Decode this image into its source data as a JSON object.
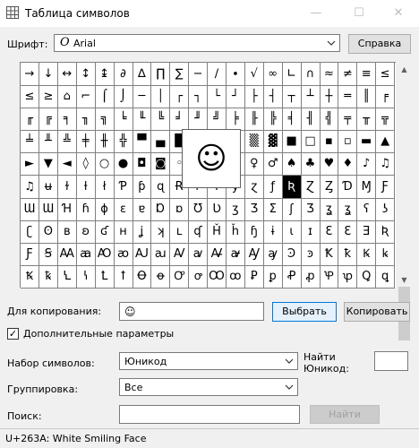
{
  "window": {
    "title": "Таблица символов",
    "minimize_glyph": "—",
    "maximize_glyph": "☐",
    "close_glyph": "✕"
  },
  "font_row": {
    "label": "Шрифт:",
    "font_icon_glyph": "O",
    "font_value": "Arial",
    "help_button": "Справка"
  },
  "grid": {
    "selected_index": 114,
    "rows": [
      [
        "→",
        "↓",
        "↔",
        "↕",
        "↨",
        "∂",
        "∆",
        "∏",
        "∑",
        "−",
        "∕",
        "∙",
        "√",
        "∞",
        "∟",
        "∩",
        "≈",
        "≠",
        "≡",
        "≤"
      ],
      [
        "≤",
        "≥",
        "⌂",
        "⌐",
        "⌠",
        "⌡",
        "─",
        "│",
        "┌",
        "┐",
        "└",
        "┘",
        "├",
        "┤",
        "┬",
        "┴",
        "┼",
        "═",
        "║",
        "╒"
      ],
      [
        "╓",
        "╔",
        "╕",
        "╖",
        "╗",
        "╘",
        "╙",
        "╚",
        "╛",
        "╜",
        "╝",
        "╞",
        "╟",
        "╠",
        "╡",
        "╢",
        "╣",
        "╤",
        "╥",
        "╦"
      ],
      [
        "╧",
        "╨",
        "╩",
        "╪",
        "╫",
        "╬",
        "▀",
        "▄",
        "█",
        "▌",
        "▐",
        "░",
        "▒",
        "▓",
        "■",
        "□",
        "▪",
        "▫",
        "▬",
        "▲"
      ],
      [
        "►",
        "▼",
        "◄",
        "◊",
        "○",
        "●",
        "◘",
        "◙",
        "◦",
        "☺",
        "☻",
        "☼",
        "♀",
        "♂",
        "♠",
        "♣",
        "♥",
        "♦",
        "♪",
        "♫"
      ],
      [
        "♫",
        "ʉ",
        "ɫ",
        "ƚ",
        "ł",
        "Ƥ",
        "ƥ",
        "ɋ",
        "Ɍ",
        "ɍ",
        "Ɏ",
        "ɏ",
        "ɀ",
        "ƒ",
        "Ʀ",
        "Ɀ",
        "Ȥ",
        "Ɗ",
        "Ɱ",
        "Ƒ"
      ],
      [
        "Ɯ",
        "Ɯ",
        "Ɦ",
        "ɦ",
        "ɸ",
        "ɛ",
        "ɐ",
        "Ɒ",
        "ɒ",
        "Ʊ",
        "Ʋ",
        "ʒ",
        "Ʒ",
        "Ʃ",
        "ʃ",
        "Ʒ",
        "ʓ",
        "ʓ",
        "ʕ",
        "ʖ"
      ],
      [
        "ʗ",
        "ʘ",
        "ʙ",
        "ʚ",
        "ʛ",
        "ʜ",
        "ʝ",
        "ʞ",
        "ʟ",
        "ʠ",
        "Ȟ",
        "ȟ",
        "ɧ",
        "ɨ",
        "ɩ",
        "ɪ",
        "Ɛ",
        "Ɛ",
        "Ǝ",
        "Ʀ"
      ],
      [
        "Ƒ",
        "Ꞩ",
        "Ꜳ",
        "ꜳ",
        "Ꜵ",
        "ꜵ",
        "Ꜷ",
        "ꜷ",
        "Ꜹ",
        "ꜹ",
        "Ꜻ",
        "ꜻ",
        "Ꜽ",
        "ꜽ",
        "Ꜿ",
        "ꜿ",
        "Ꝁ",
        "ꝁ",
        "Ꝃ",
        "ꝃ"
      ],
      [
        "Ꝅ",
        "ꝅ",
        "Ꝇ",
        "ꝇ",
        "Ꝉ",
        "ꝉ",
        "Ꝋ",
        "ꝋ",
        "Ꝍ",
        "ꝍ",
        "Ꝏ",
        "ꝏ",
        "Ꝑ",
        "ꝑ",
        "Ꝓ",
        "ꝓ",
        "Ꝕ",
        "ꝕ",
        "Ꝗ",
        "ꝗ"
      ]
    ]
  },
  "magnifier_glyph": "☺",
  "copy_row": {
    "label": "Для копирования:",
    "value": "☺",
    "select_button": "Выбрать",
    "copy_button": "Копировать"
  },
  "advanced": {
    "checked_glyph": "✓",
    "label": "Дополнительные параметры"
  },
  "charset": {
    "label": "Набор символов:",
    "value": "Юникод"
  },
  "find_unicode": {
    "label_line1": "Найти",
    "label_line2": "Юникод:",
    "value": ""
  },
  "grouping": {
    "label": "Группировка:",
    "value": "Все"
  },
  "search": {
    "label": "Поиск:",
    "value": "",
    "button": "Найти"
  },
  "status": "U+263A: White Smiling Face",
  "colors": {
    "accent": "#0078d7",
    "selected_cell_bg": "#000000",
    "grid_line": "#808080"
  }
}
